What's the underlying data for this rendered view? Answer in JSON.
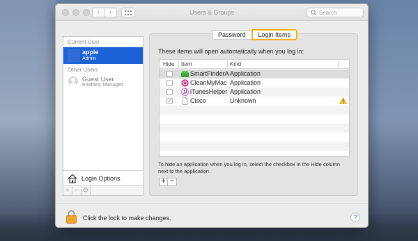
{
  "window": {
    "title": "Users & Groups",
    "search_placeholder": "Search"
  },
  "sidebar": {
    "current_user_header": "Current User",
    "current_user": {
      "name": "apple",
      "role": "Admin"
    },
    "other_users_header": "Other Users",
    "guest": {
      "name": "Guest User",
      "status": "Enabled, Managed"
    },
    "login_options": "Login Options",
    "tools": {
      "add": "+",
      "remove": "−",
      "settings": "⚙"
    }
  },
  "tabs": {
    "password": "Password",
    "login_items": "Login Items"
  },
  "panel": {
    "description": "These items will open automatically when you log in:",
    "columns": {
      "hide": "Hide",
      "item": "Item",
      "kind": "Kind"
    },
    "rows": [
      {
        "name": "SmartFinderA",
        "kind": "Application",
        "hidden": false
      },
      {
        "name": "CleanMyMac",
        "kind": "Application",
        "hidden": false
      },
      {
        "name": "iTunesHelper",
        "kind": "Application",
        "hidden": false
      },
      {
        "name": "Cisco",
        "kind": "Unknown",
        "hidden": true
      }
    ],
    "hint": "To hide an application when you log in, select the checkbox in the Hide column next to the application.",
    "add": "+",
    "remove": "−"
  },
  "footer": {
    "lock_text": "Click the lock to make changes.",
    "help": "?"
  },
  "colors": {
    "selection": "#1b62d6",
    "tab_highlight": "#f5b21b",
    "lock": "#f0a32a"
  }
}
